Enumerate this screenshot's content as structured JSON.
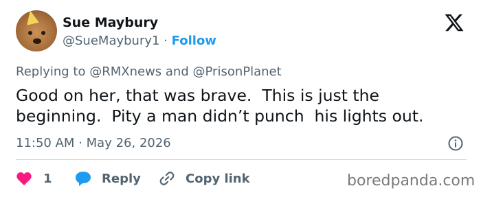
{
  "author": {
    "display_name": "Sue Maybury",
    "handle": "@SueMaybury1",
    "separator": "·",
    "follow_label": "Follow"
  },
  "reply_context": {
    "prefix": "Replying to",
    "mention_1": "@RMXnews",
    "conjunction": "and",
    "mention_2": "@PrisonPlanet"
  },
  "tweet": {
    "text": "Good on her, that was brave.  This is just the beginning.  Pity a man didn’t punch  his lights out.",
    "time": "11:50 AM",
    "separator": "·",
    "date": "May 26, 2026"
  },
  "actions": {
    "like_count": "1",
    "reply_label": "Reply",
    "copy_link_label": "Copy link"
  },
  "colors": {
    "like": "#f91880",
    "reply": "#1d9bf0",
    "follow": "#1d9bf0",
    "secondary_text": "#536471"
  },
  "icons": {
    "brand": "x-logo-icon",
    "like": "heart-icon",
    "reply": "speech-bubble-icon",
    "copy": "link-icon",
    "info": "info-icon"
  },
  "watermark": "boredpanda.com"
}
